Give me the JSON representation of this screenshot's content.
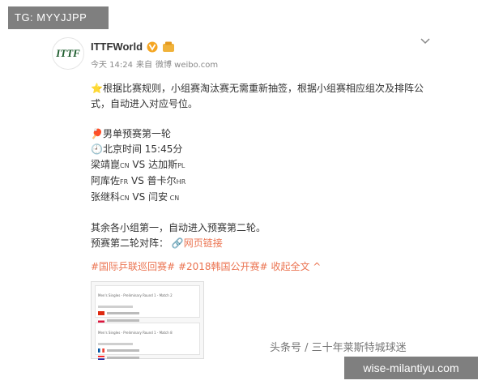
{
  "watermark_top": "TG: MYYJJPP",
  "post": {
    "author": "ITTFWorld",
    "avatar_text": "ITTF",
    "meta": {
      "time": "今天 14:24",
      "from_label": "来自",
      "source": "微博 weibo.com"
    },
    "intro_line1": "⭐根据比赛规则，小组赛淘汰赛无需重新抽签，根据小组赛相应组次及排阵公",
    "intro_line2": "式，自动进入对应号位。",
    "section_title": "🏓男单预赛第一轮",
    "time_line": "🕘北京时间 15:45分",
    "matches": [
      {
        "p1": "梁靖崑",
        "c1": "CN",
        "vs": " VS ",
        "p2": "达加斯",
        "c2": "PL"
      },
      {
        "p1": "阿库佐",
        "c1": "FR",
        "vs": " VS ",
        "p2": "普卡尔",
        "c2": "HR"
      },
      {
        "p1": "张继科",
        "c1": "CN",
        "vs": " VS ",
        "p2": "闫安",
        "c2": " CN"
      }
    ],
    "others_line": "其余各小组第一，自动进入预赛第二轮。",
    "round2_label": "预赛第二轮对阵：",
    "web_link": "🔗网页链接",
    "hashtags": [
      "#国际乒联巡回赛#",
      "#2018韩国公开赛#",
      "收起全文 ^"
    ],
    "thumb": {
      "block1_title": "Men's Singles - Preliminary Round 1 - Match 2",
      "block2_title": "Men's Singles - Preliminary Round 1 - Match 8"
    }
  },
  "watermark_source": "头条号 / 三十年莱斯特城球迷",
  "watermark_site": "wise-milantiyu.com",
  "colors": {
    "accent": "#eb7350",
    "watermark_bg": "#7f7f7f",
    "verified": "#f5a623"
  }
}
